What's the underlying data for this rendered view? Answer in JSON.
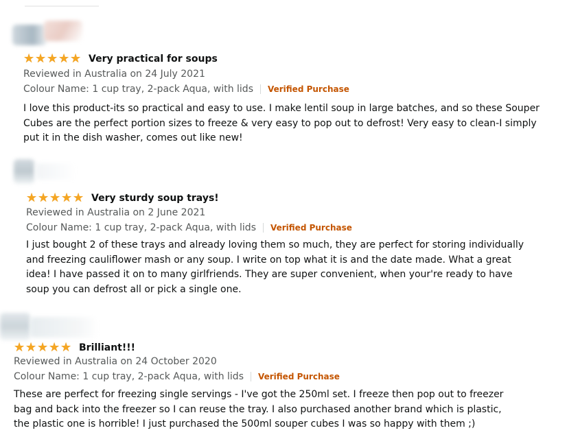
{
  "reviews": [
    {
      "rating": 5,
      "stars_filled": 5,
      "title": "Very practical for soups",
      "reviewed_line": "Reviewed in Australia on 24 July 2021",
      "variant": "Colour Name: 1 cup tray, 2-pack Aqua, with lids",
      "verified": "Verified Purchase",
      "body": "I love this product-its so practical and easy to use. I make lentil soup in large batches, and so these Souper Cubes are the perfect portion sizes to freeze & very easy to pop out to defrost! Very easy to clean-I simply put it in the dish washer, comes out like new!"
    },
    {
      "rating": 5,
      "stars_filled": 5,
      "title": "Very sturdy soup trays!",
      "reviewed_line": "Reviewed in Australia on 2 June 2021",
      "variant": "Colour Name: 1 cup tray, 2-pack Aqua, with lids",
      "verified": "Verified Purchase",
      "body": "I just bought 2 of these trays and already loving them so much, they are perfect for storing individually and freezing cauliflower mash or any soup. I write on top what it is and the date made. What a great idea! I have passed it on to many girlfriends. They are super convenient, when your're ready to have soup you can defrost all or pick a single one."
    },
    {
      "rating": 5,
      "stars_filled": 5,
      "title": "Brilliant!!!",
      "reviewed_line": "Reviewed in Australia on 24 October 2020",
      "variant": "Colour Name: 1 cup tray, 2-pack Aqua, with lids",
      "verified": "Verified Purchase",
      "body": "These are perfect for freezing single servings - I've got the 250ml set. I freeze then pop out to freezer bag and back into the freezer so I can reuse the tray. I also purchased another brand which is plastic, the plastic one is horrible! I just purchased the 500ml souper cubes I was so happy with them ;)"
    }
  ],
  "colors": {
    "star": "#f5a623",
    "verified": "#c45500",
    "meta": "#565959",
    "text": "#0f1111"
  },
  "icons": {
    "star": "star-icon",
    "avatar": "blurred-avatar-icon"
  }
}
